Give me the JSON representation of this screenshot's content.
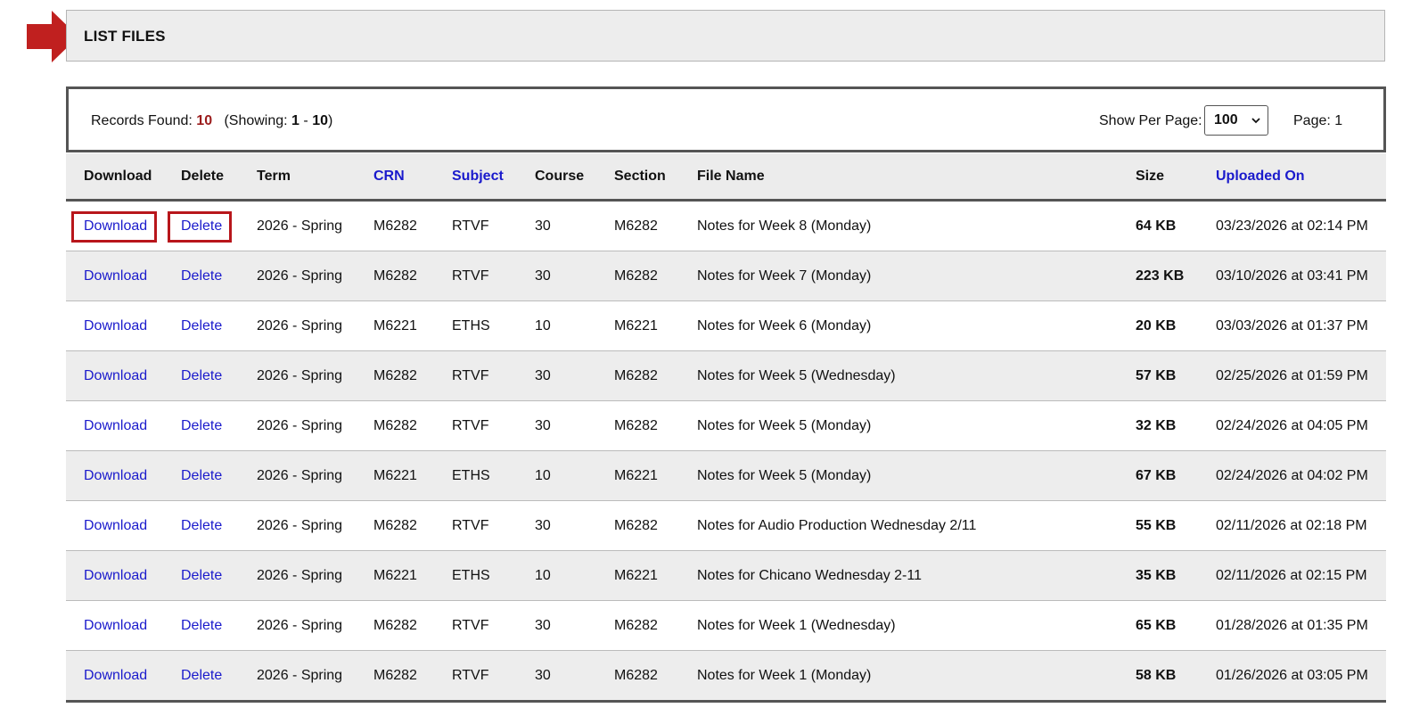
{
  "page": {
    "title": "LIST FILES",
    "highlight_color": "#c0201f"
  },
  "summary": {
    "records_label": "Records Found:",
    "records_count": "10",
    "showing_prefix": "(Showing:",
    "showing_from": "1",
    "showing_sep": "-",
    "showing_to": "10",
    "showing_suffix": ")",
    "per_page_label": "Show Per Page:",
    "per_page_value": "100",
    "page_label": "Page: 1"
  },
  "table": {
    "headers": {
      "download": "Download",
      "delete": "Delete",
      "term": "Term",
      "crn": "CRN",
      "subject": "Subject",
      "course": "Course",
      "section": "Section",
      "file_name": "File Name",
      "size": "Size",
      "uploaded_on": "Uploaded On"
    },
    "rows": [
      {
        "download": "Download",
        "delete": "Delete",
        "term": "2026 - Spring",
        "crn": "M6282",
        "subject": "RTVF",
        "course": "30",
        "section": "M6282",
        "file_name": "Notes for Week 8 (Monday)",
        "size": "64 KB",
        "uploaded_on": "03/23/2026 at 02:14 PM"
      },
      {
        "download": "Download",
        "delete": "Delete",
        "term": "2026 - Spring",
        "crn": "M6282",
        "subject": "RTVF",
        "course": "30",
        "section": "M6282",
        "file_name": "Notes for Week 7 (Monday)",
        "size": "223 KB",
        "uploaded_on": "03/10/2026 at 03:41 PM"
      },
      {
        "download": "Download",
        "delete": "Delete",
        "term": "2026 - Spring",
        "crn": "M6221",
        "subject": "ETHS",
        "course": "10",
        "section": "M6221",
        "file_name": "Notes for Week 6 (Monday)",
        "size": "20 KB",
        "uploaded_on": "03/03/2026 at 01:37 PM"
      },
      {
        "download": "Download",
        "delete": "Delete",
        "term": "2026 - Spring",
        "crn": "M6282",
        "subject": "RTVF",
        "course": "30",
        "section": "M6282",
        "file_name": "Notes for Week 5 (Wednesday)",
        "size": "57 KB",
        "uploaded_on": "02/25/2026 at 01:59 PM"
      },
      {
        "download": "Download",
        "delete": "Delete",
        "term": "2026 - Spring",
        "crn": "M6282",
        "subject": "RTVF",
        "course": "30",
        "section": "M6282",
        "file_name": "Notes for Week 5 (Monday)",
        "size": "32 KB",
        "uploaded_on": "02/24/2026 at 04:05 PM"
      },
      {
        "download": "Download",
        "delete": "Delete",
        "term": "2026 - Spring",
        "crn": "M6221",
        "subject": "ETHS",
        "course": "10",
        "section": "M6221",
        "file_name": "Notes for Week 5 (Monday)",
        "size": "67 KB",
        "uploaded_on": "02/24/2026 at 04:02 PM"
      },
      {
        "download": "Download",
        "delete": "Delete",
        "term": "2026 - Spring",
        "crn": "M6282",
        "subject": "RTVF",
        "course": "30",
        "section": "M6282",
        "file_name": "Notes for Audio Production Wednesday 2/11",
        "size": "55 KB",
        "uploaded_on": "02/11/2026 at 02:18 PM"
      },
      {
        "download": "Download",
        "delete": "Delete",
        "term": "2026 - Spring",
        "crn": "M6221",
        "subject": "ETHS",
        "course": "10",
        "section": "M6221",
        "file_name": "Notes for Chicano Wednesday 2-11",
        "size": "35 KB",
        "uploaded_on": "02/11/2026 at 02:15 PM"
      },
      {
        "download": "Download",
        "delete": "Delete",
        "term": "2026 - Spring",
        "crn": "M6282",
        "subject": "RTVF",
        "course": "30",
        "section": "M6282",
        "file_name": "Notes for Week 1 (Wednesday)",
        "size": "65 KB",
        "uploaded_on": "01/28/2026 at 01:35 PM"
      },
      {
        "download": "Download",
        "delete": "Delete",
        "term": "2026 - Spring",
        "crn": "M6282",
        "subject": "RTVF",
        "course": "30",
        "section": "M6282",
        "file_name": "Notes for Week 1 (Monday)",
        "size": "58 KB",
        "uploaded_on": "01/26/2026 at 03:05 PM"
      }
    ]
  }
}
